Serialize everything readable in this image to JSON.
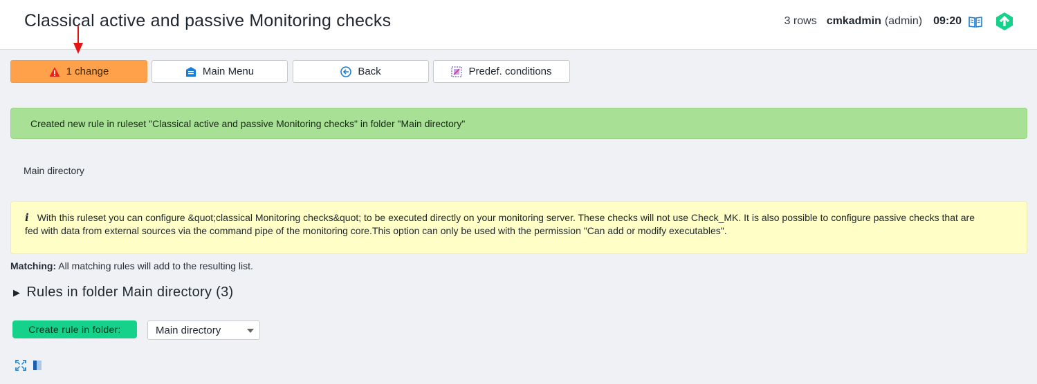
{
  "header": {
    "title": "Classical active and passive Monitoring checks",
    "rows": "3 rows",
    "user": "cmkadmin",
    "role": "(admin)",
    "time": "09:20"
  },
  "toolbar": {
    "change_label": "1 change",
    "main_menu_label": "Main Menu",
    "back_label": "Back",
    "predef_label": "Predef. conditions"
  },
  "messages": {
    "success": "Created new rule in ruleset \"Classical active and passive Monitoring checks\" in folder \"Main directory\"",
    "info": "With this ruleset you can configure &quot;classical Monitoring checks&quot; to be executed directly on your monitoring server. These checks will not use Check_MK. It is also possible to configure passive checks that are fed with data from external sources via the command pipe of the monitoring core.This option can only be used with the permission \"Can add or modify executables\".",
    "info_marker": "i"
  },
  "breadcrumb": "Main directory",
  "matching": {
    "label": "Matching:",
    "text": "All matching rules will add to the resulting list."
  },
  "rules": {
    "heading": "Rules in folder Main directory (3)",
    "create_label": "Create rule in folder:",
    "folder_value": "Main directory"
  },
  "colors": {
    "change_button": "#ffa14a",
    "success_bg": "#a8e196",
    "info_bg": "#fefec6",
    "create_button": "#15d189"
  }
}
